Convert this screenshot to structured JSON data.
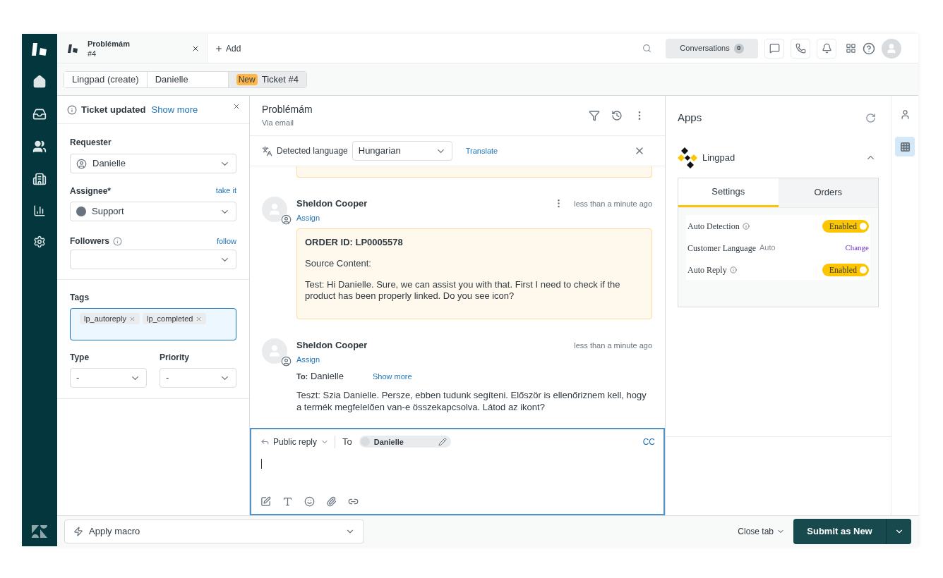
{
  "header": {
    "tabs": [
      {
        "title": "Problémám",
        "subtitle": "#4",
        "selected": true
      }
    ],
    "add_label": "Add",
    "conversations": {
      "label": "Conversations",
      "count": "0"
    }
  },
  "breadcrumbs": [
    {
      "label": "Lingpad (create)",
      "selected": false
    },
    {
      "label": "Danielle",
      "selected": false
    },
    {
      "label": "Ticket #4",
      "badge": "New",
      "selected": true
    }
  ],
  "notice": {
    "title": "Ticket updated",
    "link": "Show more"
  },
  "fields": {
    "requester": {
      "label": "Requester",
      "value": "Danielle"
    },
    "assignee": {
      "label": "Assignee*",
      "action": "take it",
      "value": "Support"
    },
    "followers": {
      "label": "Followers",
      "action": "follow"
    },
    "tags": {
      "label": "Tags",
      "items": [
        "lp_autoreply",
        "lp_completed"
      ]
    },
    "type": {
      "label": "Type",
      "value": "-"
    },
    "priority": {
      "label": "Priority",
      "value": "-"
    }
  },
  "conversation": {
    "title": "Problémám",
    "channel": "Via email",
    "translate": {
      "label": "Detected language",
      "language": "Hungarian",
      "action": "Translate"
    },
    "messages": [
      {
        "kind": "note",
        "author": "Sheldon Cooper",
        "action": "Assign",
        "time": "less than a minute ago",
        "menu": true,
        "lines": [
          "ORDER ID: LP0005578",
          "Source Content:",
          "Test: Hi Danielle. Sure, we can assist you with that. First I need to check if the product has been properly linked. Do you see icon?"
        ]
      },
      {
        "kind": "email",
        "author": "Sheldon Cooper",
        "action": "Assign",
        "time": "less than a minute ago",
        "menu": false,
        "to_label": "To:",
        "to": "Danielle",
        "show_more": "Show more",
        "lines": [
          "Teszt: Szia Danielle. Persze, ebben tudunk segíteni. Először is ellenőriznem kell, hogy a termék megfelelően van-e összekapcsolva. Látod az ikont?"
        ]
      }
    ],
    "reply": {
      "mode": "Public reply",
      "to_label": "To",
      "recipient": "Danielle",
      "cc": "CC"
    }
  },
  "apps": {
    "title": "Apps",
    "app": {
      "name": "Lingpad",
      "expanded": true,
      "tabs": [
        {
          "label": "Settings",
          "selected": true
        },
        {
          "label": "Orders",
          "selected": false
        }
      ],
      "settings": [
        {
          "kind": "toggle",
          "label": "Auto Detection",
          "value": "Enabled",
          "on": true
        },
        {
          "kind": "link",
          "label": "Customer Language",
          "hint": "Auto",
          "action": "Change"
        },
        {
          "kind": "toggle",
          "label": "Auto Reply",
          "value": "Enabled",
          "on": true
        }
      ]
    }
  },
  "right_rail": [
    {
      "kind": "user",
      "selected": false
    },
    {
      "kind": "apps",
      "selected": true
    }
  ],
  "footer": {
    "macro": "Apply macro",
    "close_tab": "Close tab",
    "submit": "Submit as New"
  }
}
